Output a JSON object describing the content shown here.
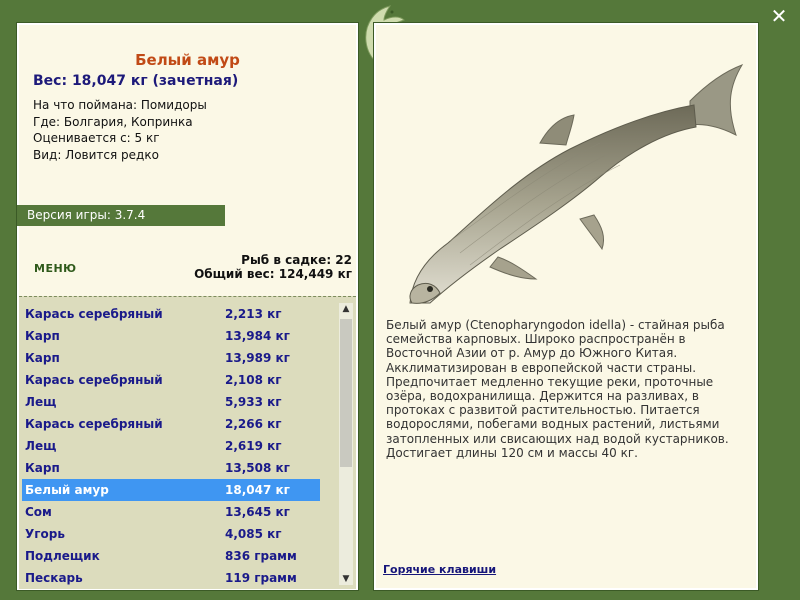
{
  "fish": {
    "name": "Белый амур",
    "weight_line": "Вес: 18,047 кг (зачетная)",
    "bait_line": "На что поймана: Помидоры",
    "place_line": "Где: Болгария, Копринка",
    "rated_line": "Оценивается с: 5 кг",
    "kind_line": "Вид: Ловится редко",
    "description": "Белый амур (Ctenopharyngodon idella) - стайная рыба семейства карповых. Широко распространён в Восточной Азии от р. Амур до Южного Китая. Акклиматизирован в европейской части страны. Предпочитает медленно текущие реки, проточные озёра, водохранилища. Держится на разливах, в протоках с развитой растительностью. Питается водорослями, побегами водных растений, листьями затопленных или свисающих над водой кустарников. Достигает длины 120 см и массы 40 кг."
  },
  "version": "Версия игры: 3.7.4",
  "menu_label": "МЕНЮ",
  "summary": {
    "count_line": "Рыб в садке: 22",
    "total_line": "Общий вес: 124,449 кг"
  },
  "catch_list": [
    {
      "name": "Карась серебряный",
      "weight": "2,213 кг"
    },
    {
      "name": "Карп",
      "weight": "13,984 кг"
    },
    {
      "name": "Карп",
      "weight": "13,989 кг"
    },
    {
      "name": "Карась серебряный",
      "weight": "2,108 кг"
    },
    {
      "name": "Лещ",
      "weight": "5,933 кг"
    },
    {
      "name": "Карась серебряный",
      "weight": "2,266 кг"
    },
    {
      "name": "Лещ",
      "weight": "2,619 кг"
    },
    {
      "name": "Карп",
      "weight": "13,508 кг"
    },
    {
      "name": "Белый амур",
      "weight": "18,047 кг",
      "selected": true
    },
    {
      "name": "Сом",
      "weight": "13,645 кг"
    },
    {
      "name": "Угорь",
      "weight": "4,085 кг"
    },
    {
      "name": "Подлещик",
      "weight": "836 грамм"
    },
    {
      "name": "Пескарь",
      "weight": "119 грамм"
    }
  ],
  "hotkeys_label": "Горячие клавиши",
  "icons": {
    "close": "close-icon",
    "emblem": "fish-emblem-icon",
    "scroll_up": "scroll-up-icon",
    "scroll_down": "scroll-down-icon"
  },
  "colors": {
    "frame_green": "#55783a",
    "panel_bg": "#fbf8e6",
    "title_orange": "#c14a16",
    "selected_blue": "#3f96f2"
  }
}
